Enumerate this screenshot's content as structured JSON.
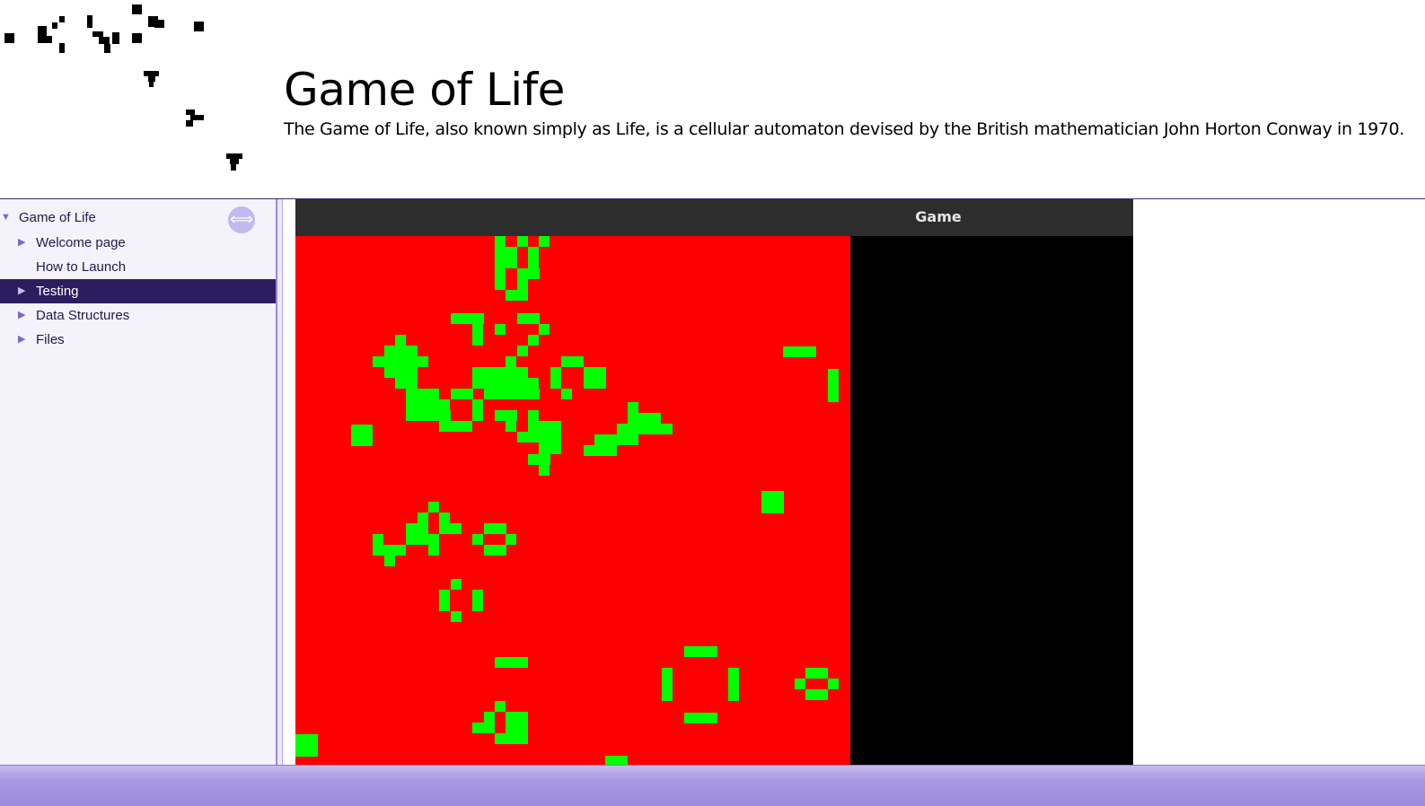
{
  "header": {
    "title": "Game of Life",
    "subtitle": "The Game of Life, also known simply as Life, is a cellular automaton devised by the British mathematician John Horton Conway in 1970."
  },
  "sidebar": {
    "sync_icon": "double-arrow-icon",
    "items": [
      {
        "label": "Game of Life",
        "arrow": "▼",
        "selected": false
      },
      {
        "label": "Welcome page",
        "arrow": "▶",
        "selected": false
      },
      {
        "label": "How to Launch",
        "arrow": "",
        "selected": false
      },
      {
        "label": "Testing",
        "arrow": "▶",
        "selected": true
      },
      {
        "label": "Data Structures",
        "arrow": "▶",
        "selected": false
      },
      {
        "label": "Files",
        "arrow": "▶",
        "selected": false
      }
    ]
  },
  "game": {
    "window_title": "Game",
    "dead_color": "#ff0000",
    "alive_color": "#00ff00",
    "side_color": "#000000"
  },
  "colors": {
    "sidebar_bg": "#f4f2fb",
    "selected_bg": "#2c1d5e",
    "accent": "#7a66cc",
    "footer": "#a898e2"
  }
}
